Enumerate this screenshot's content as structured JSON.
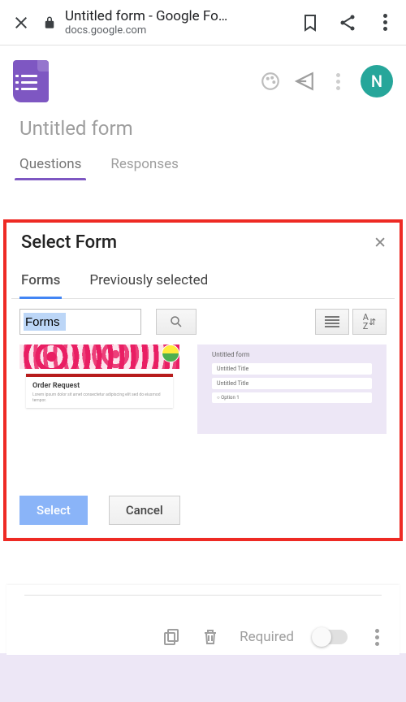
{
  "chrome": {
    "page_title": "Untitled form - Google Fo…",
    "page_url": "docs.google.com"
  },
  "app": {
    "avatar_letter": "N",
    "form_title": "Untitled form",
    "tabs": {
      "questions": "Questions",
      "responses": "Responses"
    }
  },
  "modal": {
    "title": "Select Form",
    "tabs": {
      "forms": "Forms",
      "prev": "Previously selected"
    },
    "search_value": "Forms",
    "thumbs": {
      "order_title": "Order Request",
      "untitled_title": "Untitled form",
      "line_a": "Untitled Title",
      "line_b": "Untitled Title"
    },
    "buttons": {
      "select": "Select",
      "cancel": "Cancel"
    }
  },
  "bottom": {
    "required_label": "Required"
  }
}
